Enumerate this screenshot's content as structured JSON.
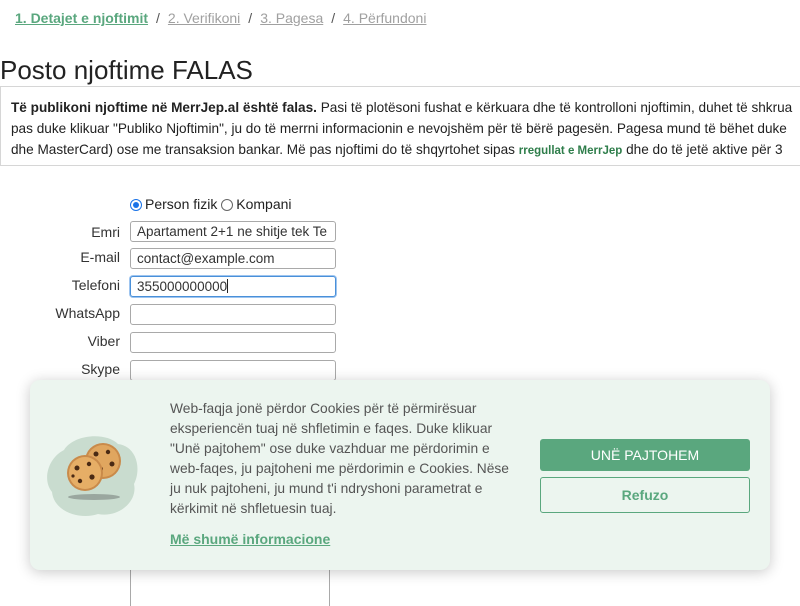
{
  "breadcrumb": {
    "step1": "1. Detajet e njoftimit",
    "step2": "2. Verifikoni",
    "step3": "3. Pagesa",
    "step4": "4. Përfundoni",
    "separator": "/"
  },
  "page_title": "Posto njoftime FALAS",
  "info": {
    "bold_lead": "Të publikoni njoftime në MerrJep.al është falas.",
    "line1_rest": " Pasi të plotësoni fushat e kërkuara dhe të kontrolloni njoftimin, duhet të shkrua",
    "line2": "pas duke klikuar \"Publiko Njoftimin\", ju do të merrni informacionin e nevojshëm për të bërë pagesën. Pagesa mund të bëhet duke",
    "line3_start": "dhe MasterCard) ose me transaksion bankar. Më pas njoftimi do të shqyrtohet sipas ",
    "rules_link": "rregullat e MerrJep",
    "line3_end": " dhe do të jetë aktive për 3"
  },
  "form": {
    "radio_person": "Person fizik",
    "radio_company": "Kompani",
    "name_label": "Emri",
    "name_value": "Apartament 2+1 ne shitje tek Te",
    "email_label": "E-mail",
    "email_value": "contact@example.com",
    "phone_label": "Telefoni",
    "phone_value": "355000000000",
    "whatsapp_label": "WhatsApp",
    "viber_label": "Viber",
    "skype_label": "Skype"
  },
  "cookie": {
    "text": "Web-faqja jonë përdor Cookies për të përmirësuar eksperiencën tuaj në shfletimin e faqes. Duke klikuar \"Unë pajtohem\" ose duke vazhduar me përdorimin e web-faqes, ju pajtoheni me përdorimin e Cookies. Nëse ju nuk pajtoheni, ju mund t'i ndryshoni parametrat e kërkimit në shfletuesin tuaj.",
    "more_link": "Më shumë informacione",
    "agree_button": "UNË PAJTOHEM",
    "refuse_button": "Refuzo"
  },
  "colors": {
    "accent_green": "#5aa77e",
    "banner_bg": "#ecf5ef"
  }
}
